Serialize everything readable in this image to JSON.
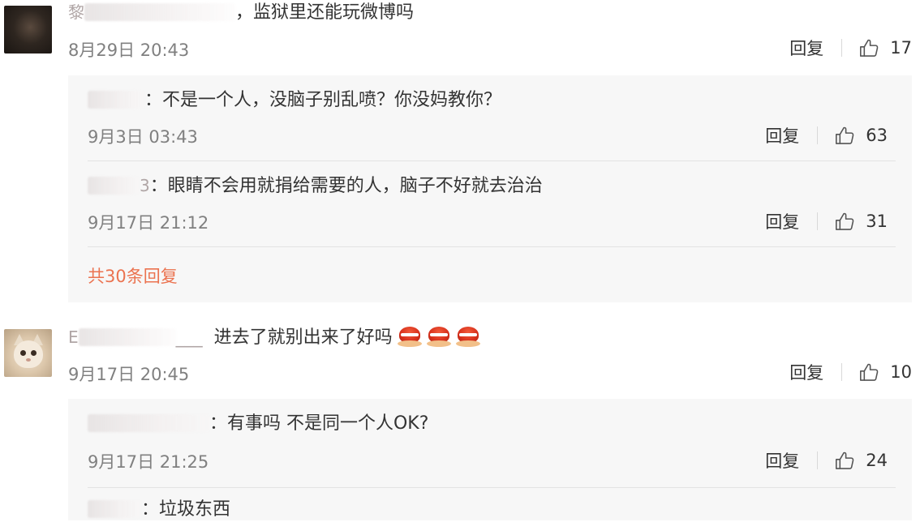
{
  "comments": [
    {
      "author_fragment": "黎",
      "text": "，监狱里还能玩微博吗",
      "time": "8月29日 20:43",
      "reply_label": "回复",
      "likes": "17",
      "replies": [
        {
          "author_fragment": "",
          "text": "：不是一个人，没脑子别乱喷？你没妈教你？",
          "time": "9月3日 03:43",
          "reply_label": "回复",
          "likes": "63"
        },
        {
          "author_fragment": "3",
          "text": "：眼睛不会用就捐给需要的人，脑子不好就去治治",
          "time": "9月17日 21:12",
          "reply_label": "回复",
          "likes": "31"
        }
      ],
      "more_replies_label": "共30条回复"
    },
    {
      "author_fragment": "E",
      "text": "进去了就别出来了好吗",
      "emoji_count": 3,
      "time": "9月17日 20:45",
      "reply_label": "回复",
      "likes": "10",
      "replies": [
        {
          "author_fragment": "",
          "text": "：有事吗 不是同一个人OK?",
          "time": "9月17日 21:25",
          "reply_label": "回复",
          "likes": "24"
        },
        {
          "author_fragment": "",
          "text": "：垃圾东西"
        }
      ]
    }
  ],
  "icons": {
    "like": "thumbs-up-icon",
    "emoji": "red-lantern-emoji"
  },
  "colors": {
    "link_orange": "#eb7350",
    "meta_gray": "#808080",
    "reply_bg": "#f7f7f7"
  }
}
